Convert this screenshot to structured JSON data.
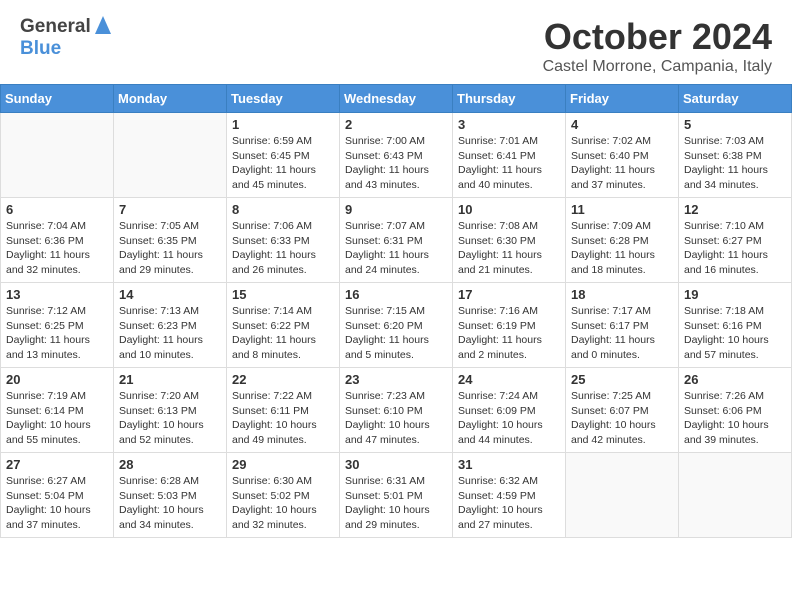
{
  "header": {
    "logo_general": "General",
    "logo_blue": "Blue",
    "month": "October 2024",
    "location": "Castel Morrone, Campania, Italy"
  },
  "calendar": {
    "headers": [
      "Sunday",
      "Monday",
      "Tuesday",
      "Wednesday",
      "Thursday",
      "Friday",
      "Saturday"
    ],
    "weeks": [
      [
        {
          "day": "",
          "text": ""
        },
        {
          "day": "",
          "text": ""
        },
        {
          "day": "1",
          "text": "Sunrise: 6:59 AM\nSunset: 6:45 PM\nDaylight: 11 hours and 45 minutes."
        },
        {
          "day": "2",
          "text": "Sunrise: 7:00 AM\nSunset: 6:43 PM\nDaylight: 11 hours and 43 minutes."
        },
        {
          "day": "3",
          "text": "Sunrise: 7:01 AM\nSunset: 6:41 PM\nDaylight: 11 hours and 40 minutes."
        },
        {
          "day": "4",
          "text": "Sunrise: 7:02 AM\nSunset: 6:40 PM\nDaylight: 11 hours and 37 minutes."
        },
        {
          "day": "5",
          "text": "Sunrise: 7:03 AM\nSunset: 6:38 PM\nDaylight: 11 hours and 34 minutes."
        }
      ],
      [
        {
          "day": "6",
          "text": "Sunrise: 7:04 AM\nSunset: 6:36 PM\nDaylight: 11 hours and 32 minutes."
        },
        {
          "day": "7",
          "text": "Sunrise: 7:05 AM\nSunset: 6:35 PM\nDaylight: 11 hours and 29 minutes."
        },
        {
          "day": "8",
          "text": "Sunrise: 7:06 AM\nSunset: 6:33 PM\nDaylight: 11 hours and 26 minutes."
        },
        {
          "day": "9",
          "text": "Sunrise: 7:07 AM\nSunset: 6:31 PM\nDaylight: 11 hours and 24 minutes."
        },
        {
          "day": "10",
          "text": "Sunrise: 7:08 AM\nSunset: 6:30 PM\nDaylight: 11 hours and 21 minutes."
        },
        {
          "day": "11",
          "text": "Sunrise: 7:09 AM\nSunset: 6:28 PM\nDaylight: 11 hours and 18 minutes."
        },
        {
          "day": "12",
          "text": "Sunrise: 7:10 AM\nSunset: 6:27 PM\nDaylight: 11 hours and 16 minutes."
        }
      ],
      [
        {
          "day": "13",
          "text": "Sunrise: 7:12 AM\nSunset: 6:25 PM\nDaylight: 11 hours and 13 minutes."
        },
        {
          "day": "14",
          "text": "Sunrise: 7:13 AM\nSunset: 6:23 PM\nDaylight: 11 hours and 10 minutes."
        },
        {
          "day": "15",
          "text": "Sunrise: 7:14 AM\nSunset: 6:22 PM\nDaylight: 11 hours and 8 minutes."
        },
        {
          "day": "16",
          "text": "Sunrise: 7:15 AM\nSunset: 6:20 PM\nDaylight: 11 hours and 5 minutes."
        },
        {
          "day": "17",
          "text": "Sunrise: 7:16 AM\nSunset: 6:19 PM\nDaylight: 11 hours and 2 minutes."
        },
        {
          "day": "18",
          "text": "Sunrise: 7:17 AM\nSunset: 6:17 PM\nDaylight: 11 hours and 0 minutes."
        },
        {
          "day": "19",
          "text": "Sunrise: 7:18 AM\nSunset: 6:16 PM\nDaylight: 10 hours and 57 minutes."
        }
      ],
      [
        {
          "day": "20",
          "text": "Sunrise: 7:19 AM\nSunset: 6:14 PM\nDaylight: 10 hours and 55 minutes."
        },
        {
          "day": "21",
          "text": "Sunrise: 7:20 AM\nSunset: 6:13 PM\nDaylight: 10 hours and 52 minutes."
        },
        {
          "day": "22",
          "text": "Sunrise: 7:22 AM\nSunset: 6:11 PM\nDaylight: 10 hours and 49 minutes."
        },
        {
          "day": "23",
          "text": "Sunrise: 7:23 AM\nSunset: 6:10 PM\nDaylight: 10 hours and 47 minutes."
        },
        {
          "day": "24",
          "text": "Sunrise: 7:24 AM\nSunset: 6:09 PM\nDaylight: 10 hours and 44 minutes."
        },
        {
          "day": "25",
          "text": "Sunrise: 7:25 AM\nSunset: 6:07 PM\nDaylight: 10 hours and 42 minutes."
        },
        {
          "day": "26",
          "text": "Sunrise: 7:26 AM\nSunset: 6:06 PM\nDaylight: 10 hours and 39 minutes."
        }
      ],
      [
        {
          "day": "27",
          "text": "Sunrise: 6:27 AM\nSunset: 5:04 PM\nDaylight: 10 hours and 37 minutes."
        },
        {
          "day": "28",
          "text": "Sunrise: 6:28 AM\nSunset: 5:03 PM\nDaylight: 10 hours and 34 minutes."
        },
        {
          "day": "29",
          "text": "Sunrise: 6:30 AM\nSunset: 5:02 PM\nDaylight: 10 hours and 32 minutes."
        },
        {
          "day": "30",
          "text": "Sunrise: 6:31 AM\nSunset: 5:01 PM\nDaylight: 10 hours and 29 minutes."
        },
        {
          "day": "31",
          "text": "Sunrise: 6:32 AM\nSunset: 4:59 PM\nDaylight: 10 hours and 27 minutes."
        },
        {
          "day": "",
          "text": ""
        },
        {
          "day": "",
          "text": ""
        }
      ]
    ]
  }
}
